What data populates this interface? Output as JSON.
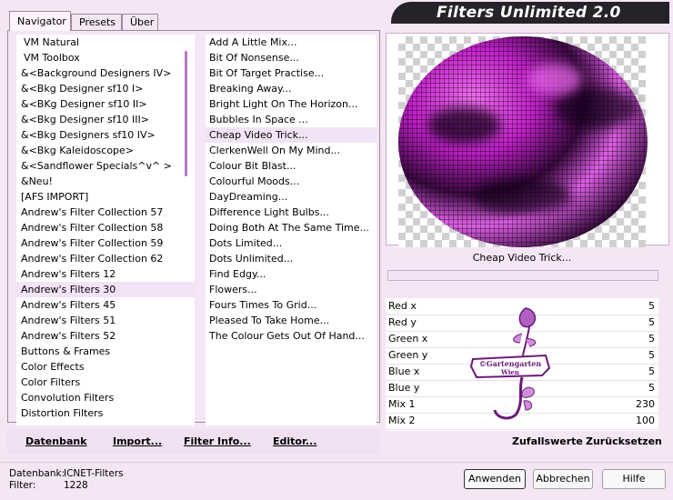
{
  "header": {
    "title": "Filters Unlimited 2.0"
  },
  "tabs": [
    {
      "label": "Navigator",
      "active": true
    },
    {
      "label": "Presets",
      "active": false
    },
    {
      "label": "Über",
      "active": false
    }
  ],
  "categories": [
    "VM Natural",
    "VM Toolbox",
    "&<Background Designers IV>",
    "&<Bkg Designer sf10 I>",
    "&<BKg Designer sf10 II>",
    "&<Bkg Designer sf10 III>",
    "&<Bkg Designers sf10 IV>",
    "&<Bkg Kaleidoscope>",
    "&<Sandflower Specials^v^ >",
    "&Neu!",
    "[AFS IMPORT]",
    "Andrew's Filter Collection 57",
    "Andrew's Filter Collection 58",
    "Andrew's Filter Collection 59",
    "Andrew's Filter Collection 62",
    "Andrew's Filters 12",
    "Andrew's Filters 30",
    "Andrew's Filters 45",
    "Andrew's Filters 51",
    "Andrew's Filters 52",
    "Buttons & Frames",
    "Color Effects",
    "Color Filters",
    "Convolution Filters",
    "Distortion Filters"
  ],
  "selected_category": "Andrew's Filters 30",
  "filters": [
    "Add A Little Mix...",
    "Bit Of Nonsense...",
    "Bit Of Target Practise...",
    "Breaking Away...",
    "Bright Light On The Horizon...",
    "Bubbles In Space ...",
    "Cheap Video Trick...",
    "ClerkenWell On My Mind...",
    "Colour Bit Blast...",
    "Colourful Moods...",
    "DayDreaming...",
    "Difference Light Bulbs...",
    "Doing Both At The Same Time...",
    "Dots Limited...",
    "Dots Unlimited...",
    "Find Edgy...",
    "Flowers...",
    "Fours Times To Grid...",
    "Pleased To Take Home...",
    "The Colour Gets Out Of Hand..."
  ],
  "selected_filter": "Cheap Video Trick...",
  "preview": {
    "filter_name": "Cheap Video Trick...",
    "progress": 0
  },
  "params": [
    {
      "label": "Red x",
      "value": "5"
    },
    {
      "label": "Red y",
      "value": "5"
    },
    {
      "label": "Green x",
      "value": "5"
    },
    {
      "label": "Green y",
      "value": "5"
    },
    {
      "label": "Blue x",
      "value": "5"
    },
    {
      "label": "Blue y",
      "value": "5"
    },
    {
      "label": "Mix 1",
      "value": "230"
    },
    {
      "label": "Mix 2",
      "value": "100"
    }
  ],
  "watermark": {
    "line1": "©Gartengarten",
    "line2": "Wien"
  },
  "bottom": {
    "datenbank": "Datenbank",
    "import": "Import...",
    "filter_info": "Filter Info...",
    "editor": "Editor...",
    "zufallswerte": "Zufallswerte",
    "zuruecksetzen": "Zurücksetzen"
  },
  "info": {
    "db_label": "Datenbank:",
    "db_value": "ICNET-Filters",
    "filter_label": "Filter:",
    "filter_value": "1228"
  },
  "buttons": {
    "apply": "Anwenden",
    "cancel": "Abbrechen",
    "help": "Hilfe"
  },
  "colors": {
    "accent": "#c020c8",
    "background": "#f4e6f4",
    "header": "#26222a"
  }
}
